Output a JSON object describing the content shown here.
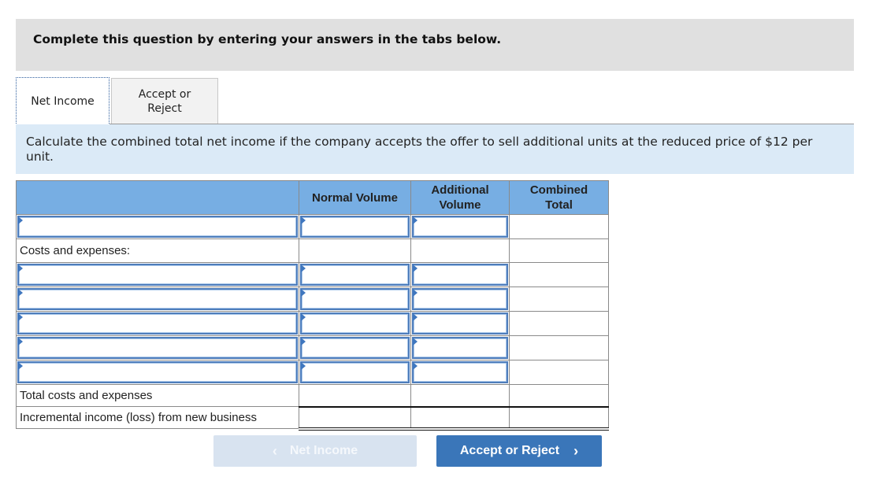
{
  "instruction": "Complete this question by entering your answers in the tabs below.",
  "tabs": [
    {
      "label": "Net Income",
      "active": true
    },
    {
      "label": "Accept or Reject",
      "active": false
    }
  ],
  "prompt": "Calculate the combined total net income if the company accepts the offer to sell additional units at the reduced price of $12 per unit.",
  "worksheet": {
    "headers": [
      "",
      "Normal Volume",
      "Additional Volume",
      "Combined Total"
    ],
    "rows": [
      {
        "type": "input",
        "label": "",
        "normal": "",
        "additional": "",
        "combined": ""
      },
      {
        "type": "label",
        "label": "Costs and expenses:"
      },
      {
        "type": "input",
        "label": "",
        "normal": "",
        "additional": "",
        "combined": ""
      },
      {
        "type": "input",
        "label": "",
        "normal": "",
        "additional": "",
        "combined": ""
      },
      {
        "type": "input",
        "label": "",
        "normal": "",
        "additional": "",
        "combined": ""
      },
      {
        "type": "input",
        "label": "",
        "normal": "",
        "additional": "",
        "combined": ""
      },
      {
        "type": "input",
        "label": "",
        "normal": "",
        "additional": "",
        "combined": ""
      },
      {
        "type": "total",
        "label": "Total costs and expenses",
        "normal": "",
        "additional": "",
        "combined": ""
      },
      {
        "type": "total",
        "label": "Incremental income (loss) from new business",
        "normal": "",
        "additional": "",
        "combined": ""
      }
    ]
  },
  "navigation": {
    "prev": {
      "label": "Net Income",
      "icon": "chevron-left-icon",
      "enabled": false
    },
    "next": {
      "label": "Accept or Reject",
      "icon": "chevron-right-icon",
      "enabled": true
    }
  },
  "colors": {
    "header_bg": "#77aee3",
    "prompt_bg": "#dbeaf7",
    "instruction_bg": "#e0e0e0",
    "next_button": "#3a76b9",
    "prev_button_disabled": "#d8e3f0"
  }
}
